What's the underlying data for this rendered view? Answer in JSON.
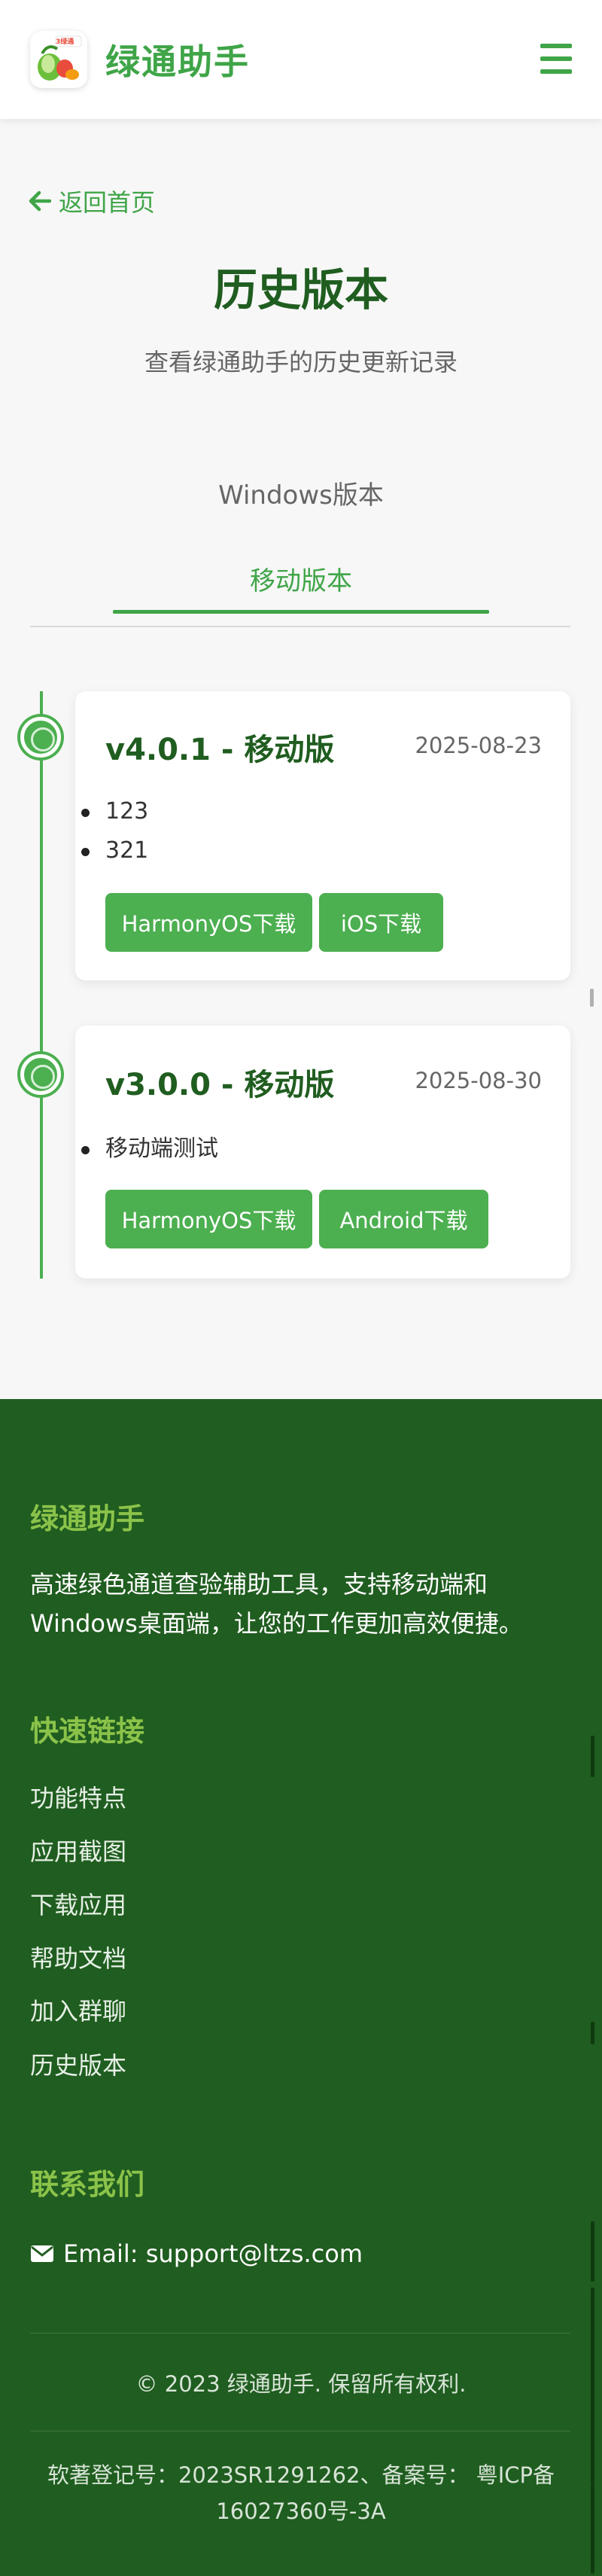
{
  "header": {
    "logo_badge": "3绿通",
    "brand": "绿通助手",
    "menu_icon": "hamburger-menu-icon"
  },
  "main": {
    "back_label": "返回首页",
    "title": "历史版本",
    "subtitle": "查看绿通助手的历史更新记录",
    "tabs": [
      {
        "label": "Windows版本",
        "active": false
      },
      {
        "label": "移动版本",
        "active": true
      }
    ]
  },
  "versions": [
    {
      "title": "v4.0.1 - 移动版",
      "date": "2025-08-23",
      "notes": [
        "123",
        "321"
      ],
      "buttons": [
        "HarmonyOS下载",
        "iOS下载"
      ]
    },
    {
      "title": "v3.0.0 - 移动版",
      "date": "2025-08-30",
      "notes": [
        "移动端测试"
      ],
      "buttons": [
        "HarmonyOS下载",
        "Android下载"
      ]
    }
  ],
  "footer": {
    "about_heading": "绿通助手",
    "about_text": "高速绿色通道查验辅助工具，支持移动端和Windows桌面端，让您的工作更加高效便捷。",
    "links_heading": "快速链接",
    "links": [
      "功能特点",
      "应用截图",
      "下载应用",
      "帮助文档",
      "加入群聊",
      "历史版本"
    ],
    "contact_heading": "联系我们",
    "email": "Email: support@ltzs.com",
    "copyright": "© 2023 绿通助手. 保留所有权利.",
    "icp": "软著登记号：2023SR1291262、备案号： 粤ICP备16027360号-3A"
  },
  "colors": {
    "brand_green": "#3fa548",
    "dark_green": "#205d20",
    "button_green": "#4caf50",
    "footer_heading": "#8bc34a"
  }
}
